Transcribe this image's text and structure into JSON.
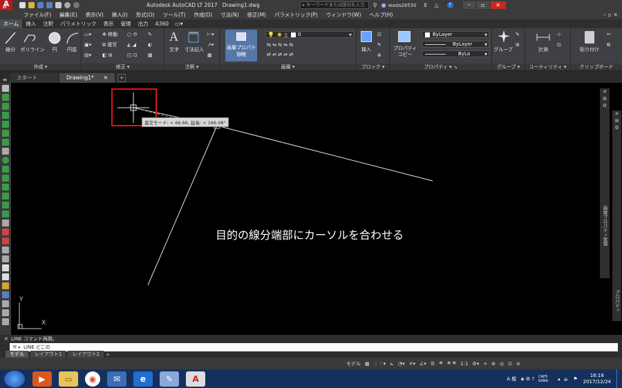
{
  "title": {
    "app": "Autodesk AutoCAD LT 2017",
    "file": "Drawing1.dwg",
    "search_placeholder": "キーワードまたは語句を入力",
    "user": "wada28530",
    "logo_sub": "LT"
  },
  "menu": [
    "ファイル(F)",
    "編集(E)",
    "表示(V)",
    "挿入(I)",
    "形式(O)",
    "ツール(T)",
    "作成(D)",
    "寸法(N)",
    "修正(M)",
    "パラメトリック(P)",
    "ウィンドウ(W)",
    "ヘルプ(H)"
  ],
  "ribbon_tabs": [
    "ホーム",
    "挿入",
    "注釈",
    "パラメトリック",
    "表示",
    "管理",
    "出力",
    "A360"
  ],
  "ribbon": {
    "draw": {
      "line": "線分",
      "polyline": "ポリライン",
      "circle": "円",
      "arc": "円弧",
      "label": "作成"
    },
    "modify": {
      "move": "移動",
      "copy": "複写",
      "label": "修正"
    },
    "annotation": {
      "text": "文字",
      "dim": "寸法記入",
      "label": "注釈"
    },
    "layers": {
      "props_line1": "画層プロパティ",
      "props_line2": "管理",
      "layer_value": "0",
      "label": "画層"
    },
    "block": {
      "insert": "挿入",
      "label": "ブロック"
    },
    "properties": {
      "copy1": "プロパティ",
      "copy2": "コピー",
      "color": "ByLayer",
      "linetype": "ByLayer",
      "lineweight": "ByLa",
      "label": "プロパティ"
    },
    "groups": {
      "group": "グループ",
      "label": "グループ"
    },
    "utilities": {
      "measure": "計測",
      "label": "ユーティリティ"
    },
    "clipboard": {
      "paste": "貼り付け",
      "label": "クリップボード"
    }
  },
  "file_tabs": [
    "スタート",
    "Drawing1*"
  ],
  "tooltip": "直交モード: < 66.66,  延長: < 166.08°",
  "annotation": "目的の線分端部にカーソルを合わせる",
  "ucs": {
    "x": "X",
    "y": "Y"
  },
  "right_palettes": [
    "画層プロパティ管理",
    "プロパティ"
  ],
  "command": {
    "history": "LINE コマンド再開。",
    "prompt": "LINE どこの"
  },
  "layout_tabs": [
    "モデル",
    "レイアウト1",
    "レイアウト2"
  ],
  "status": {
    "model": "モデル",
    "scale": "1:1"
  },
  "taskbar": {
    "ime": "A 般",
    "time": "16:16",
    "date": "2017/12/24",
    "caps": "CAPS KANA"
  },
  "colors": {
    "title_bg": "#3b3b3b",
    "canvas": "#000000",
    "highlight": "#e0141c",
    "taskbar": "#15305e",
    "accent": "#4b6aa5"
  }
}
